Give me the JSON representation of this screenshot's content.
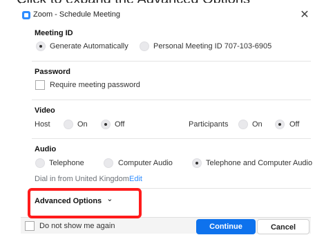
{
  "instruction": {
    "text": "Click to expand the Advanced Options"
  },
  "window": {
    "title": "Zoom - Schedule Meeting",
    "close_glyph": "✕"
  },
  "meeting_id": {
    "heading": "Meeting ID",
    "option_auto": "Generate Automatically",
    "option_personal": "Personal Meeting ID 707-103-6905",
    "selected": "auto"
  },
  "password": {
    "heading": "Password",
    "checkbox_label": "Require meeting password",
    "checked": false
  },
  "video": {
    "heading": "Video",
    "host_label": "Host",
    "participants_label": "Participants",
    "on_label": "On",
    "off_label": "Off",
    "host_value": "Off",
    "participants_value": "Off"
  },
  "audio": {
    "heading": "Audio",
    "option_telephone": "Telephone",
    "option_computer": "Computer Audio",
    "option_both": "Telephone and Computer Audio",
    "selected": "both",
    "dial_in_text": "Dial in from United Kingdom",
    "edit_label": "Edit"
  },
  "advanced": {
    "label": "Advanced Options",
    "chevron": "⌄"
  },
  "footer": {
    "checkbox_label": "Do not show me again",
    "continue_label": "Continue",
    "cancel_label": "Cancel"
  },
  "colors": {
    "primary": "#0e72ed",
    "link": "#2d8cff",
    "highlight": "#ff1b1b",
    "icon": "#2d8cff"
  },
  "icons": {
    "app": "zoom-app-icon",
    "close": "close-icon",
    "chevron": "chevron-down-icon"
  }
}
